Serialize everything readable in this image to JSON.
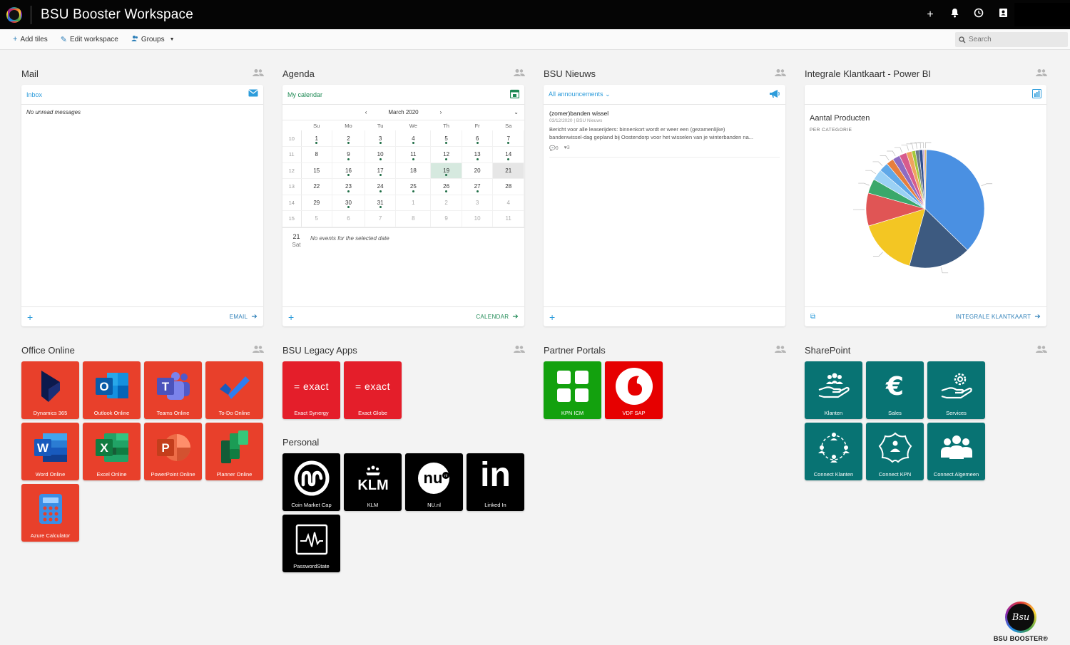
{
  "header": {
    "title": "BSU Booster Workspace"
  },
  "toolbar": {
    "add_tiles": "Add tiles",
    "edit_workspace": "Edit workspace",
    "groups": "Groups",
    "search_placeholder": "Search"
  },
  "mail": {
    "title": "Mail",
    "inbox": "Inbox",
    "empty": "No unread messages",
    "footer_link": "EMAIL"
  },
  "agenda": {
    "title": "Agenda",
    "calendar_name": "My calendar",
    "month": "March 2020",
    "weekdays": [
      "Su",
      "Mo",
      "Tu",
      "We",
      "Th",
      "Fr",
      "Sa"
    ],
    "weeks": [
      {
        "wk": "10",
        "days": [
          "1",
          "2",
          "3",
          "4",
          "5",
          "6",
          "7"
        ]
      },
      {
        "wk": "11",
        "days": [
          "8",
          "9",
          "10",
          "11",
          "12",
          "13",
          "14"
        ]
      },
      {
        "wk": "12",
        "days": [
          "15",
          "16",
          "17",
          "18",
          "19",
          "20",
          "21"
        ]
      },
      {
        "wk": "13",
        "days": [
          "22",
          "23",
          "24",
          "25",
          "26",
          "27",
          "28"
        ]
      },
      {
        "wk": "14",
        "days": [
          "29",
          "30",
          "31",
          "1",
          "2",
          "3",
          "4"
        ]
      },
      {
        "wk": "15",
        "days": [
          "5",
          "6",
          "7",
          "8",
          "9",
          "10",
          "11"
        ]
      }
    ],
    "selected_day": "21",
    "selected_weekday": "Sat",
    "no_events": "No events for the selected date",
    "footer_link": "CALENDAR"
  },
  "news": {
    "title": "BSU Nieuws",
    "filter": "All announcements",
    "item": {
      "headline": "(zomer)banden wissel",
      "meta": "03/12/2020 | BSU Nieuws",
      "line1": "Bericht voor alle leaserijders: binnenkort wordt er weer een (gezamenlijke)",
      "line2": "bandenwissel-dag gepland bij Oostendorp voor het wisselen van je winterbanden na...",
      "comments": "0",
      "likes": "3"
    }
  },
  "powerbi": {
    "title": "Integrale Klantkaart - Power BI",
    "chart_title": "Aantal Producten",
    "chart_subtitle": "PER CATEGORIE",
    "footer_link": "INTEGRALE KLANTKAART"
  },
  "chart_data": {
    "type": "pie",
    "title": "Aantal Producten",
    "subtitle": "PER CATEGORIE",
    "values": [
      37,
      17,
      16,
      9,
      4,
      3,
      2.5,
      2,
      2,
      2,
      1.5,
      1,
      1,
      1,
      0.5,
      0.5
    ],
    "colors": [
      "#4a90e2",
      "#3d5a80",
      "#f3c623",
      "#e05555",
      "#3aa86b",
      "#9ad1f5",
      "#5fa8e8",
      "#e67e3d",
      "#8e6bc2",
      "#d75b8d",
      "#f0a35e",
      "#a5c93b",
      "#6c7a89",
      "#2f4f8f",
      "#c5a8e0",
      "#e8c070"
    ]
  },
  "office": {
    "title": "Office Online",
    "tiles": [
      {
        "label": "Dynamics 365"
      },
      {
        "label": "Outlook Online"
      },
      {
        "label": "Teams Online"
      },
      {
        "label": "To-Do Online"
      },
      {
        "label": "Word Online"
      },
      {
        "label": "Excel Online"
      },
      {
        "label": "PowerPoint Online"
      },
      {
        "label": "Planner Online"
      },
      {
        "label": "Azure Calculator"
      }
    ],
    "letters": {
      "outlook": "O",
      "teams": "T",
      "word": "W",
      "excel": "X",
      "ppt": "P"
    }
  },
  "legacy": {
    "title": "BSU Legacy Apps",
    "logo_text": "= exact",
    "tiles": [
      {
        "label": "Exact Synergy"
      },
      {
        "label": "Exact Globe"
      }
    ]
  },
  "partner": {
    "title": "Partner Portals",
    "tiles": [
      {
        "label": "KPN ICM"
      },
      {
        "label": "VDF SAP"
      }
    ]
  },
  "personal": {
    "title": "Personal",
    "tiles": [
      {
        "label": "Coin Market Cap"
      },
      {
        "label": "KLM"
      },
      {
        "label": "NU.nl"
      },
      {
        "label": "Linked In"
      },
      {
        "label": "PasswordState"
      }
    ],
    "klm_text": "KLM",
    "nu_text": "nu",
    "nu_badge": "nl",
    "in_text": "in"
  },
  "sharepoint": {
    "title": "SharePoint",
    "tiles": [
      {
        "label": "Klanten"
      },
      {
        "label": "Sales"
      },
      {
        "label": "Services"
      },
      {
        "label": "Connect Klanten"
      },
      {
        "label": "Connect KPN"
      },
      {
        "label": "Connect Algemeen"
      }
    ],
    "euro": "€"
  },
  "brand": {
    "name": "BSU BOOSTER®",
    "mark": "Bsu"
  }
}
